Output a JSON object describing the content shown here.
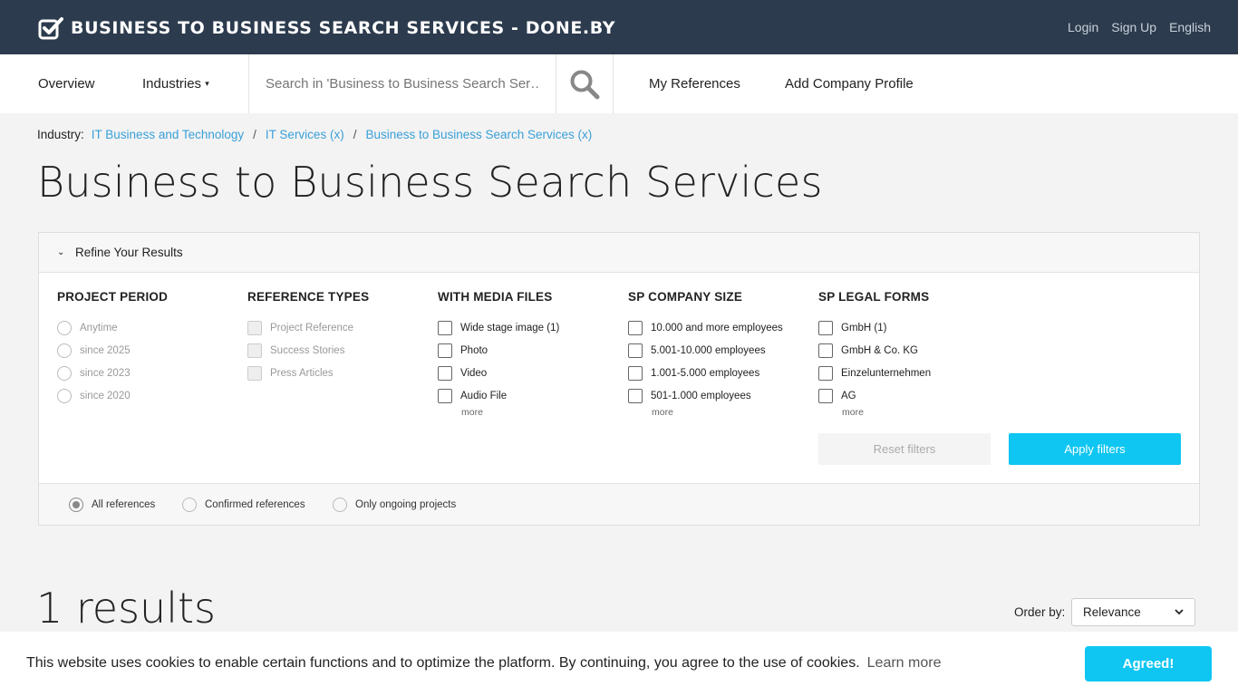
{
  "header": {
    "site_title": "BUSINESS TO BUSINESS SEARCH SERVICES - DONE.BY",
    "links": [
      "Login",
      "Sign Up",
      "English"
    ]
  },
  "nav": {
    "overview": "Overview",
    "industries": "Industries",
    "search_placeholder": "Search in 'Business to Business Search Ser…",
    "my_references": "My References",
    "add_company_profile": "Add Company Profile"
  },
  "breadcrumb": {
    "label": "Industry:",
    "items": [
      "IT Business and Technology",
      "IT Services (x)",
      "Business to Business Search Services (x)"
    ]
  },
  "page_title": "Business to Business Search Services",
  "filters": {
    "heading": "Refine Your Results",
    "project_period": {
      "title": "PROJECT PERIOD",
      "options": [
        "Anytime",
        "since 2025",
        "since 2023",
        "since 2020"
      ]
    },
    "reference_types": {
      "title": "REFERENCE TYPES",
      "options": [
        "Project Reference",
        "Success Stories",
        "Press Articles"
      ]
    },
    "media_files": {
      "title": "WITH MEDIA FILES",
      "options": [
        "Wide stage image (1)",
        "Photo",
        "Video",
        "Audio File"
      ],
      "more": "more"
    },
    "company_size": {
      "title": "SP COMPANY SIZE",
      "options": [
        "10.000 and more employees",
        "5.001-10.000 employees",
        "1.001-5.000 employees",
        "501-1.000 employees"
      ],
      "more": "more"
    },
    "legal_forms": {
      "title": "SP LEGAL FORMS",
      "options": [
        "GmbH (1)",
        "GmbH & Co. KG",
        "Einzelunternehmen",
        "AG"
      ],
      "more": "more"
    },
    "reset_label": "Reset filters",
    "apply_label": "Apply filters",
    "scope": {
      "options": [
        "All references",
        "Confirmed references",
        "Only ongoing projects"
      ],
      "selected": "All references"
    }
  },
  "results": {
    "count_text": "1 results",
    "order_label": "Order by:",
    "order_value": "Relevance"
  },
  "cookie": {
    "text": "This website uses cookies to enable certain functions and to optimize the platform. By continuing, you agree to the use of cookies.",
    "learn_more": "Learn more",
    "button": "Agreed!"
  },
  "colors": {
    "header_bg": "#2c3b4d",
    "accent": "#0fc6f2",
    "link": "#3aa0d8"
  }
}
